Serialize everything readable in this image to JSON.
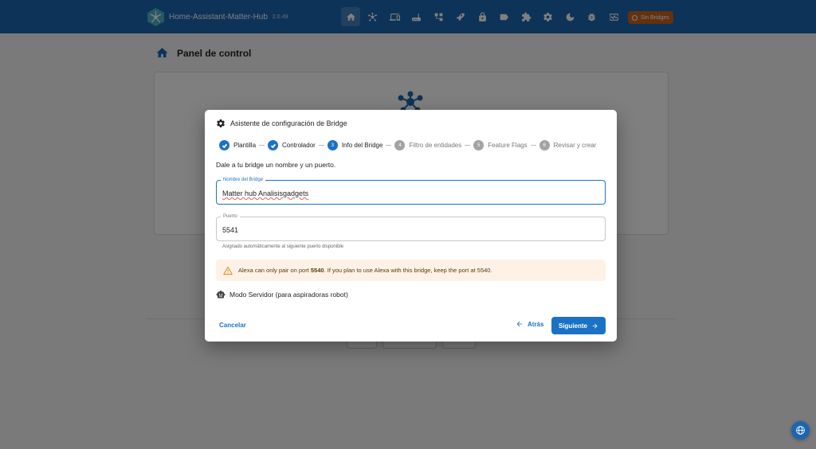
{
  "app": {
    "title": "Home-Assistant-Matter-Hub",
    "version": "2.0.49",
    "badge": "Sin Bridges",
    "nav_icons": [
      "home-icon",
      "hub-icon",
      "devices-icon",
      "router-icon",
      "network-icon",
      "rocket-icon",
      "lock-icon",
      "label-icon",
      "puzzle-icon",
      "settings-icon",
      "dark-mode-icon",
      "bug-icon",
      "monitor-heart-icon"
    ]
  },
  "page": {
    "title": "Panel de control"
  },
  "dialog": {
    "title": "Asistente de configuración de Bridge",
    "steps": [
      {
        "num": "1",
        "label": "Plantilla",
        "state": "done"
      },
      {
        "num": "2",
        "label": "Controlador",
        "state": "done"
      },
      {
        "num": "3",
        "label": "Info del Bridge",
        "state": "active"
      },
      {
        "num": "4",
        "label": "Filtro de entidades",
        "state": "todo"
      },
      {
        "num": "5",
        "label": "Feature Flags",
        "state": "todo"
      },
      {
        "num": "6",
        "label": "Revisar y crear",
        "state": "todo"
      }
    ],
    "intro": "Dale a tu bridge un nombre y un puerto.",
    "name_field": {
      "label": "Nombre del Bridge",
      "value": "Matter hub Analisisgadgets"
    },
    "port_field": {
      "label": "Puerto",
      "value": "5541",
      "helper": "Asignado automáticamente al siguiente puerto disponible"
    },
    "alert": {
      "pre": "Alexa can only pair on port ",
      "port": "5540",
      "post": ". If you plan to use Alexa with this bridge, keep the port at 5540."
    },
    "server_mode": "Modo Servidor (para aspiradoras robot)",
    "cancel": "Cancelar",
    "back": "Atrás",
    "next": "Siguiente"
  },
  "colors": {
    "primary": "#1b66b1",
    "badge": "#c9621f",
    "alert_bg": "#fdf2e5"
  }
}
